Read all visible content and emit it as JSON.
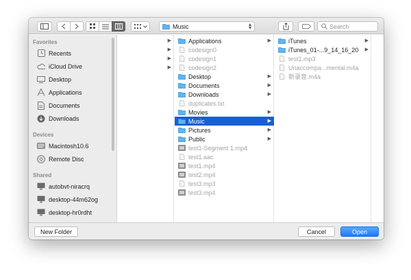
{
  "toolbar": {
    "path_label": "Music",
    "search_placeholder": "Search"
  },
  "sidebar": {
    "favorites_heading": "Favorites",
    "favorites": [
      {
        "label": "Recents",
        "icon": "clock-icon"
      },
      {
        "label": "iCloud Drive",
        "icon": "cloud-icon"
      },
      {
        "label": "Desktop",
        "icon": "desktop-icon"
      },
      {
        "label": "Applications",
        "icon": "applications-icon"
      },
      {
        "label": "Documents",
        "icon": "documents-icon"
      },
      {
        "label": "Downloads",
        "icon": "downloads-icon"
      }
    ],
    "devices_heading": "Devices",
    "devices": [
      {
        "label": "Macintosh10.6",
        "icon": "harddrive-icon"
      },
      {
        "label": "Remote Disc",
        "icon": "disc-icon"
      }
    ],
    "shared_heading": "Shared",
    "shared": [
      {
        "label": "autobvt-niracrq",
        "icon": "computer-icon"
      },
      {
        "label": "desktop-44m62og",
        "icon": "computer-icon"
      },
      {
        "label": "desktop-hr0rdht",
        "icon": "computer-icon"
      }
    ]
  },
  "column2": {
    "items": [
      {
        "label": "Applications",
        "kind": "folder",
        "dim": false,
        "arrow": true
      },
      {
        "label": "codesign0",
        "kind": "file",
        "dim": true,
        "arrow": false
      },
      {
        "label": "codesign1",
        "kind": "file",
        "dim": true,
        "arrow": false
      },
      {
        "label": "codesign2",
        "kind": "file",
        "dim": true,
        "arrow": false
      },
      {
        "label": "Desktop",
        "kind": "folder",
        "dim": false,
        "arrow": true
      },
      {
        "label": "Documents",
        "kind": "folder",
        "dim": false,
        "arrow": true
      },
      {
        "label": "Downloads",
        "kind": "folder",
        "dim": false,
        "arrow": true
      },
      {
        "label": "duplicates.txt",
        "kind": "file",
        "dim": true,
        "arrow": false
      },
      {
        "label": "Movies",
        "kind": "folder",
        "dim": false,
        "arrow": true
      },
      {
        "label": "Music",
        "kind": "folder",
        "dim": false,
        "arrow": true,
        "selected": true
      },
      {
        "label": "Pictures",
        "kind": "folder",
        "dim": false,
        "arrow": true
      },
      {
        "label": "Public",
        "kind": "folder",
        "dim": false,
        "arrow": true
      },
      {
        "label": "test1-Segment 1.mp4",
        "kind": "video",
        "dim": true,
        "arrow": false
      },
      {
        "label": "test1.aac",
        "kind": "file",
        "dim": true,
        "arrow": false
      },
      {
        "label": "test1.mp4",
        "kind": "video",
        "dim": true,
        "arrow": false
      },
      {
        "label": "test2.mp4",
        "kind": "video",
        "dim": true,
        "arrow": false
      },
      {
        "label": "test3.mp3",
        "kind": "file",
        "dim": true,
        "arrow": false
      },
      {
        "label": "test3.mp4",
        "kind": "video",
        "dim": true,
        "arrow": false
      }
    ]
  },
  "column3": {
    "items": [
      {
        "label": "iTunes",
        "kind": "folder",
        "dim": false,
        "arrow": true
      },
      {
        "label": "iTunes_01-...9_14_16_20",
        "kind": "folder",
        "dim": false,
        "arrow": true
      },
      {
        "label": "test1.mp3",
        "kind": "file",
        "dim": true,
        "arrow": false
      },
      {
        "label": "Unaccompa...mental.m4a",
        "kind": "file",
        "dim": true,
        "arrow": false
      },
      {
        "label": "新录音.m4a",
        "kind": "file",
        "dim": true,
        "arrow": false
      }
    ]
  },
  "footer": {
    "new_folder": "New Folder",
    "cancel": "Cancel",
    "open": "Open"
  },
  "colors": {
    "selection": "#1560d7",
    "folder": "#5fb4f2",
    "primary_button": "#1a7bff"
  }
}
